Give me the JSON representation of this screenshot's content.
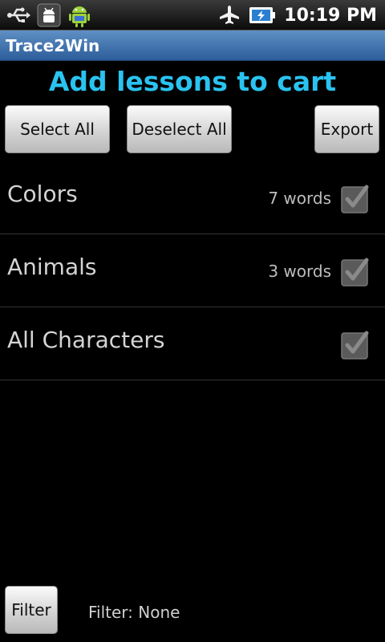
{
  "status_bar": {
    "time": "10:19 PM",
    "icons": [
      "usb-icon",
      "android-debug-icon",
      "android-mascot-icon",
      "airplane-icon",
      "battery-charging-icon"
    ]
  },
  "app": {
    "title": "Trace2Win"
  },
  "heading": "Add lessons to cart",
  "toolbar": {
    "select_all": "Select All",
    "deselect_all": "Deselect All",
    "export": "Export"
  },
  "lessons": [
    {
      "name": "Colors",
      "count": "7 words",
      "checked": true
    },
    {
      "name": "Animals",
      "count": "3 words",
      "checked": true
    },
    {
      "name": "All Characters",
      "count": "",
      "checked": true
    }
  ],
  "footer": {
    "filter_label": "Filter",
    "filter_status": "Filter: None"
  },
  "colors": {
    "accent": "#2ac3f0",
    "titlebar": "#3f73b0"
  }
}
